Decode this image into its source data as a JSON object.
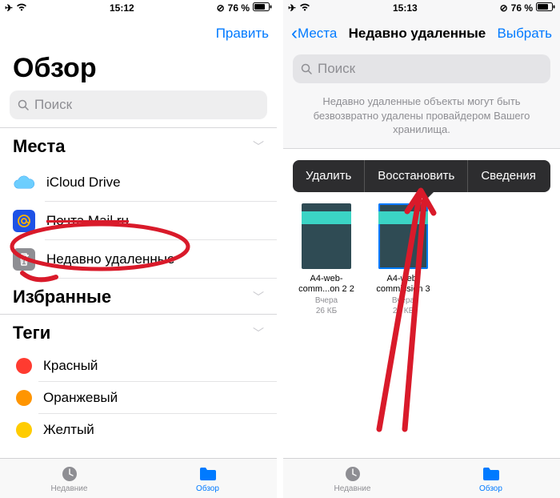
{
  "left": {
    "status": {
      "time": "15:12",
      "battery": "76 %"
    },
    "nav": {
      "edit": "Править"
    },
    "title": "Обзор",
    "search_placeholder": "Поиск",
    "sections": {
      "places": {
        "title": "Места",
        "items": [
          {
            "label": "iCloud Drive",
            "icon": "icloud"
          },
          {
            "label": "Почта Mail.ru",
            "icon": "mailru"
          },
          {
            "label": "Недавно удаленные",
            "icon": "trash"
          }
        ]
      },
      "favorites": {
        "title": "Избранные"
      },
      "tags": {
        "title": "Теги",
        "items": [
          {
            "label": "Красный",
            "color": "#ff3b30"
          },
          {
            "label": "Оранжевый",
            "color": "#ff9500"
          },
          {
            "label": "Желтый",
            "color": "#ffcc00"
          }
        ]
      }
    },
    "tabs": {
      "recent": "Недавние",
      "browse": "Обзор"
    }
  },
  "right": {
    "status": {
      "time": "15:13",
      "battery": "76 %"
    },
    "nav": {
      "back": "Места",
      "title": "Недавно удаленные",
      "select": "Выбрать"
    },
    "search_placeholder": "Поиск",
    "help": "Недавно удаленные объекты могут быть безвозвратно удалены провайдером Вашего хранилища.",
    "popover": {
      "delete": "Удалить",
      "restore": "Восстановить",
      "info": "Сведения"
    },
    "files": [
      {
        "name": "A4-web-comm...on 2 2",
        "date": "Вчера",
        "size": "26 КБ"
      },
      {
        "name": "A4-web-commission 3",
        "date": "Вчера",
        "size": "26 КБ"
      }
    ],
    "tabs": {
      "recent": "Недавние",
      "browse": "Обзор"
    }
  }
}
